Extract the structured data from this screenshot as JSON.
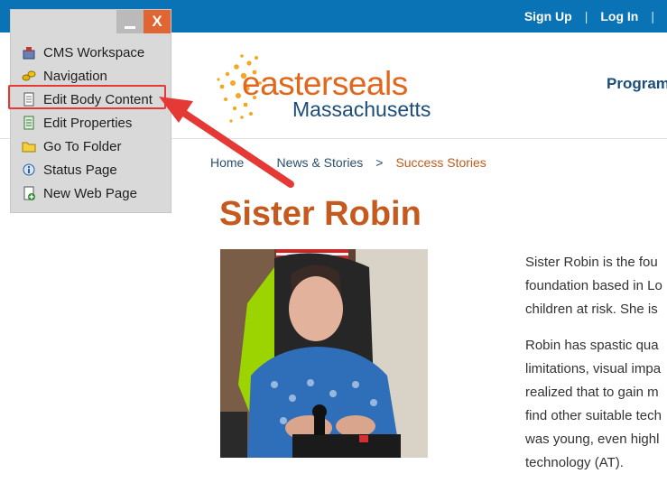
{
  "header": {
    "sign_up": "Sign Up",
    "log_in": "Log In",
    "separator": "|",
    "programs": "Programs"
  },
  "logo": {
    "line1": "easterseals",
    "line2": "Massachusetts"
  },
  "breadcrumb": {
    "home": "Home",
    "news": "News & Stories",
    "current": "Success Stories",
    "separator": ">"
  },
  "page": {
    "title": "Sister Robin"
  },
  "article": {
    "para1": [
      "Sister Robin is the fou",
      "foundation based in Lo",
      "children at risk. She is"
    ],
    "para2": [
      "Robin has spastic qua",
      "limitations, visual impa",
      "realized that to gain m",
      "find other suitable tech",
      "was young, even highl",
      "technology (AT)."
    ]
  },
  "cms_menu": {
    "minimize_label": "minimize",
    "close_label": "X",
    "items": [
      {
        "label": "CMS Workspace",
        "icon": "workspace-icon"
      },
      {
        "label": "Navigation",
        "icon": "navigation-icon"
      },
      {
        "label": "Edit Body Content",
        "icon": "document-icon"
      },
      {
        "label": "Edit Properties",
        "icon": "properties-icon"
      },
      {
        "label": "Go To Folder",
        "icon": "folder-icon"
      },
      {
        "label": "Status Page",
        "icon": "status-icon"
      },
      {
        "label": "New Web Page",
        "icon": "new-page-icon"
      }
    ],
    "highlighted_item": "Edit Body Content"
  },
  "colors": {
    "topbar": "#0a73b6",
    "accent_orange": "#c45a1e",
    "navy": "#1c4d7a",
    "annotation_red": "#e53935"
  }
}
